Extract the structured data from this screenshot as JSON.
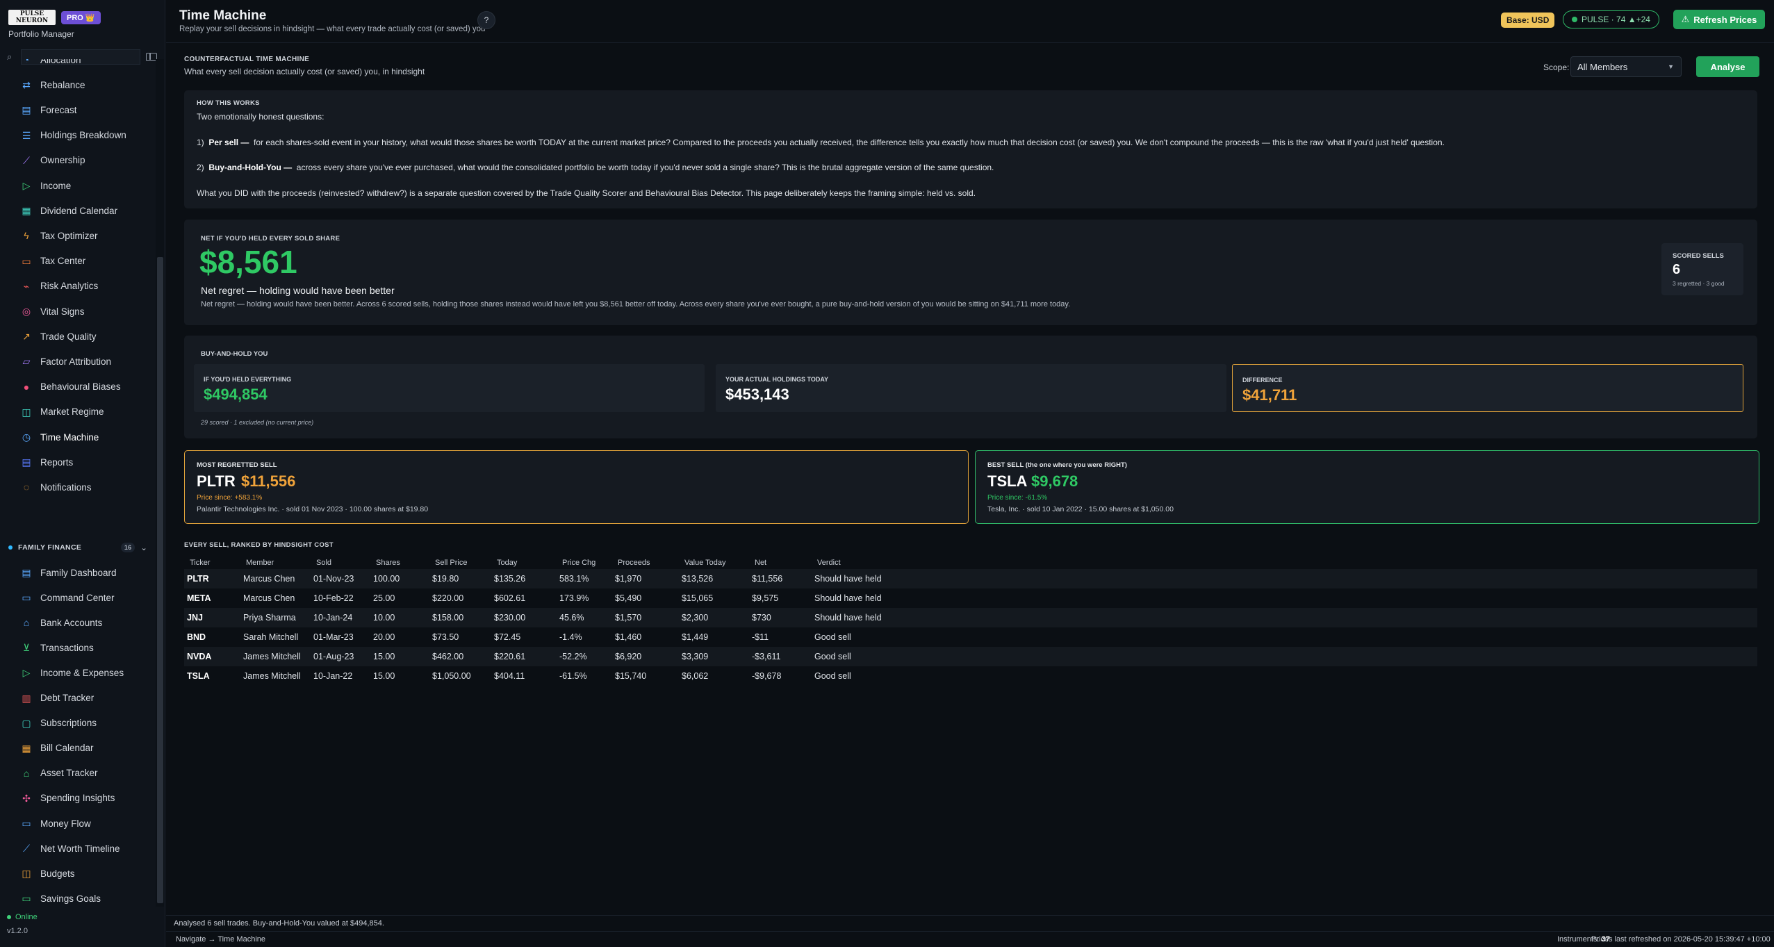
{
  "sidebar": {
    "logo_text": "PULSE NEURON",
    "pro_badge": "PRO 👑",
    "subtitle": "Portfolio Manager",
    "search_placeholder": "",
    "items": [
      {
        "label": "Allocation",
        "icon": "pie-icon",
        "color": "#5aa9ff"
      },
      {
        "label": "Rebalance",
        "icon": "rebalance-icon",
        "color": "#5aa9ff"
      },
      {
        "label": "Forecast",
        "icon": "forecast-icon",
        "color": "#5aa9ff"
      },
      {
        "label": "Holdings Breakdown",
        "icon": "layers-icon",
        "color": "#5aa9ff"
      },
      {
        "label": "Ownership",
        "icon": "ownership-icon",
        "color": "#a57cff"
      },
      {
        "label": "Income",
        "icon": "income-icon",
        "color": "#3fd27a"
      },
      {
        "label": "Dividend Calendar",
        "icon": "calendar-icon",
        "color": "#3fd2c0"
      },
      {
        "label": "Tax Optimizer",
        "icon": "bolt-icon",
        "color": "#f0a33a"
      },
      {
        "label": "Tax Center",
        "icon": "tax-icon",
        "color": "#f07a3a"
      },
      {
        "label": "Risk Analytics",
        "icon": "risk-icon",
        "color": "#f05a5a"
      },
      {
        "label": "Vital Signs",
        "icon": "vitals-icon",
        "color": "#f05a9a"
      },
      {
        "label": "Trade Quality",
        "icon": "trade-icon",
        "color": "#f0a33a"
      },
      {
        "label": "Factor Attribution",
        "icon": "factor-icon",
        "color": "#a57cff"
      },
      {
        "label": "Behavioural Biases",
        "icon": "bias-icon",
        "color": "#f0507a"
      },
      {
        "label": "Market Regime",
        "icon": "regime-icon",
        "color": "#3fd2c0"
      },
      {
        "label": "Time Machine",
        "icon": "clock-icon",
        "color": "#5aa9ff"
      },
      {
        "label": "Reports",
        "icon": "report-icon",
        "color": "#5a7bff"
      },
      {
        "label": "Notifications",
        "icon": "bell-icon",
        "color": "#f0a33a"
      }
    ],
    "family": {
      "title": "FAMILY FINANCE",
      "count": "16",
      "items": [
        {
          "label": "Family Dashboard",
          "icon": "family-icon",
          "color": "#5aa9ff"
        },
        {
          "label": "Command Center",
          "icon": "command-icon",
          "color": "#5aa9ff"
        },
        {
          "label": "Bank Accounts",
          "icon": "bank-icon",
          "color": "#5aa9ff"
        },
        {
          "label": "Transactions",
          "icon": "cart-icon",
          "color": "#3fd27a"
        },
        {
          "label": "Income & Expenses",
          "icon": "income-icon",
          "color": "#3fd27a"
        },
        {
          "label": "Debt Tracker",
          "icon": "debt-icon",
          "color": "#f05a5a"
        },
        {
          "label": "Subscriptions",
          "icon": "subscriptions-icon",
          "color": "#3fd2c0"
        },
        {
          "label": "Bill Calendar",
          "icon": "calendar-icon",
          "color": "#f0a33a"
        },
        {
          "label": "Asset Tracker",
          "icon": "home-icon",
          "color": "#3fd27a"
        },
        {
          "label": "Spending Insights",
          "icon": "insight-icon",
          "color": "#f05a9a"
        },
        {
          "label": "Money Flow",
          "icon": "flow-icon",
          "color": "#5aa9ff"
        },
        {
          "label": "Net Worth Timeline",
          "icon": "timeline-icon",
          "color": "#5aa9ff"
        },
        {
          "label": "Budgets",
          "icon": "budget-icon",
          "color": "#f0a33a"
        },
        {
          "label": "Savings Goals",
          "icon": "savings-icon",
          "color": "#3fd27a"
        }
      ]
    },
    "status": "Online",
    "version": "v1.2.0"
  },
  "header": {
    "title": "Time Machine",
    "subtitle": "Replay your sell decisions in hindsight — what every trade actually cost (or saved) you",
    "help": "?",
    "base": "Base: USD",
    "pulse": "PULSE · 74  ▲+24",
    "refresh": "Refresh Prices"
  },
  "counterfactual": {
    "heading": "COUNTERFACTUAL TIME MACHINE",
    "subheading": "What every sell decision actually cost (or saved) you, in hindsight",
    "scope_label": "Scope:",
    "scope_value": "All Members",
    "analyse": "Analyse"
  },
  "how": {
    "heading": "HOW THIS WORKS",
    "intro": "Two emotionally honest questions:",
    "p1_bold": "Per sell —",
    "p1": "for each shares-sold event in your history, what would those shares be worth TODAY at the current market price? Compared to the proceeds you actually received, the difference tells you exactly how much that decision cost (or saved) you. We don't compound the proceeds — this is the raw 'what if you'd just held' question.",
    "p2_bold": "Buy-and-Hold-You —",
    "p2": "across every share you've ever purchased, what would the consolidated portfolio be worth today if you'd never sold a single share? This is the brutal aggregate version of the same question.",
    "p3": "What you DID with the proceeds (reinvested? withdrew?) is a separate question covered by the Trade Quality Scorer and Behavioural Bias Detector. This page deliberately keeps the framing simple: held vs. sold."
  },
  "net": {
    "heading": "NET IF YOU'D HELD EVERY SOLD SHARE",
    "value": "$8,561",
    "title": "Net regret — holding would have been better",
    "description": "Net regret — holding would have been better. Across 6 scored sells, holding those shares instead would have left you $8,561 better off today. Across every share you've ever bought, a pure buy-and-hold version of you would be sitting on $41,711 more today.",
    "scored_label": "SCORED SELLS",
    "scored_value": "6",
    "scored_sub": "3 regretted · 3 good"
  },
  "bah": {
    "heading": "BUY-AND-HOLD YOU",
    "held_label": "IF YOU'D HELD EVERYTHING",
    "held_value": "$494,854",
    "actual_label": "YOUR ACTUAL HOLDINGS TODAY",
    "actual_value": "$453,143",
    "diff_label": "DIFFERENCE",
    "diff_value": "$41,711",
    "foot": "29 scored · 1 excluded (no current price)"
  },
  "worst": {
    "heading": "MOST REGRETTED SELL",
    "ticker": "PLTR",
    "amount": "$11,556",
    "since": "Price since: +583.1%",
    "detail": "Palantir Technologies Inc. · sold 01 Nov 2023 · 100.00 shares at $19.80"
  },
  "best": {
    "heading": "BEST SELL (the one where you were RIGHT)",
    "ticker": "TSLA",
    "amount": "$9,678",
    "since": "Price since: -61.5%",
    "detail": "Tesla, Inc. · sold 10 Jan 2022 · 15.00 shares at $1,050.00"
  },
  "table": {
    "heading": "EVERY SELL, RANKED BY HINDSIGHT COST",
    "columns": [
      "Ticker",
      "Member",
      "Sold",
      "Shares",
      "Sell Price",
      "Today",
      "Price Chg",
      "Proceeds",
      "Value Today",
      "Net",
      "Verdict"
    ],
    "rows": [
      [
        "PLTR",
        "Marcus Chen",
        "01-Nov-23",
        "100.00",
        "$19.80",
        "$135.26",
        "583.1%",
        "$1,970",
        "$13,526",
        "$11,556",
        "Should have held"
      ],
      [
        "META",
        "Marcus Chen",
        "10-Feb-22",
        "25.00",
        "$220.00",
        "$602.61",
        "173.9%",
        "$5,490",
        "$15,065",
        "$9,575",
        "Should have held"
      ],
      [
        "JNJ",
        "Priya Sharma",
        "10-Jan-24",
        "10.00",
        "$158.00",
        "$230.00",
        "45.6%",
        "$1,570",
        "$2,300",
        "$730",
        "Should have held"
      ],
      [
        "BND",
        "Sarah Mitchell",
        "01-Mar-23",
        "20.00",
        "$73.50",
        "$72.45",
        "-1.4%",
        "$1,460",
        "$1,449",
        "-$11",
        "Good sell"
      ],
      [
        "NVDA",
        "James Mitchell",
        "01-Aug-23",
        "15.00",
        "$462.00",
        "$220.61",
        "-52.2%",
        "$6,920",
        "$3,309",
        "-$3,611",
        "Good sell"
      ],
      [
        "TSLA",
        "James Mitchell",
        "10-Jan-22",
        "15.00",
        "$1,050.00",
        "$404.11",
        "-61.5%",
        "$15,740",
        "$6,062",
        "-$9,678",
        "Good sell"
      ]
    ]
  },
  "status_bar": "Analysed 6 sell trades. Buy-and-Hold-You valued at $494,854.",
  "footer": {
    "breadcrumb": "Navigate → Time Machine",
    "instruments_label": "Instruments:",
    "instruments_value": "37",
    "last_refresh": "Prices last refreshed on 2026-05-20 15:39:47 +10:00"
  },
  "colors": {
    "green": "#2fc964",
    "amber": "#f0a33a",
    "accent_green_button": "#22a25a"
  }
}
